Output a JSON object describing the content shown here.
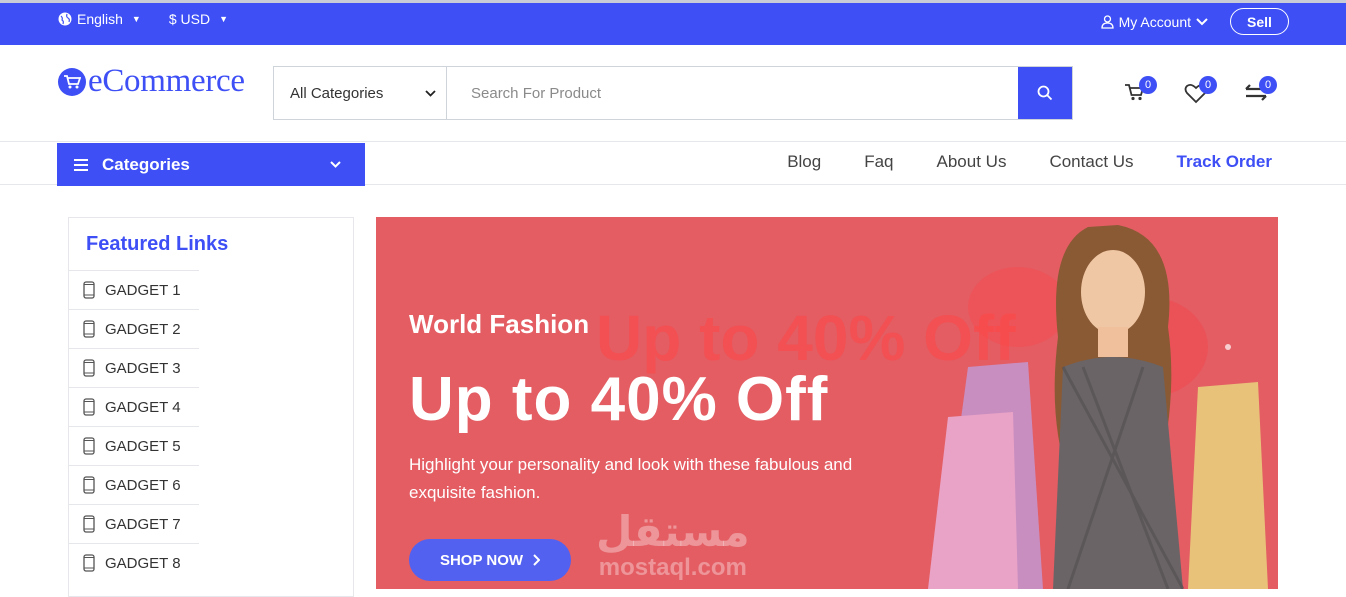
{
  "topbar": {
    "language": "English",
    "currency": "$ USD",
    "account": "My Account",
    "sell": "Sell"
  },
  "header": {
    "logo_text": "eCommerce",
    "category_select": "All Categories",
    "search_placeholder": "Search For Product",
    "cart_count": "0",
    "wishlist_count": "0",
    "compare_count": "0"
  },
  "nav": {
    "categories_label": "Categories",
    "links": [
      "Blog",
      "Faq",
      "About Us",
      "Contact Us",
      "Track Order"
    ]
  },
  "sidebar": {
    "title": "Featured Links",
    "items": [
      "GADGET 1",
      "GADGET 2",
      "GADGET 3",
      "GADGET 4",
      "GADGET 5",
      "GADGET 6",
      "GADGET 7",
      "GADGET 8"
    ]
  },
  "banner": {
    "subtitle": "World Fashion",
    "title": "Up to 40% Off",
    "description": "Highlight your personality and look with these fabulous and exquisite fashion.",
    "button": "SHOP NOW",
    "watermark_ar": "مستقل",
    "watermark_en": "mostaql.com"
  },
  "colors": {
    "primary": "#3d4ff5",
    "banner_bg": "#e35d63"
  }
}
